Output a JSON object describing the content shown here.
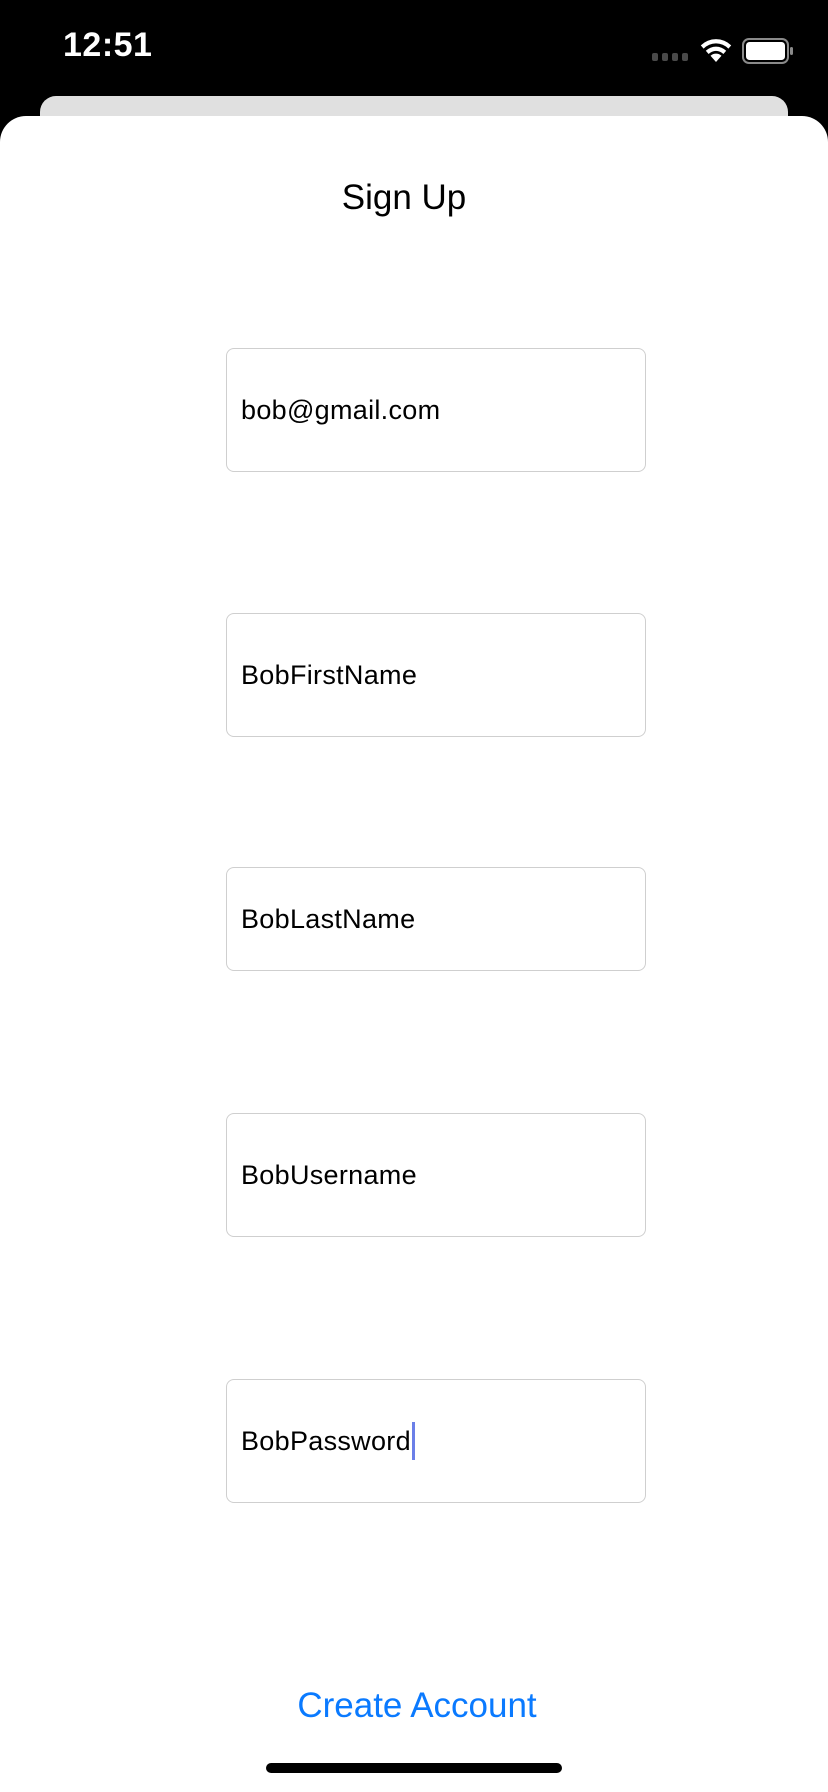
{
  "status_bar": {
    "time": "12:51"
  },
  "sheet": {
    "title": "Sign Up",
    "fields": {
      "email": "bob@gmail.com",
      "first_name": "BobFirstName",
      "last_name": "BobLastName",
      "username": "BobUsername",
      "password": "BobPassword"
    },
    "create_account_label": "Create Account"
  },
  "icons": {
    "signal": "cellular-signal-icon",
    "wifi": "wifi-icon",
    "battery": "battery-icon"
  },
  "colors": {
    "accent": "#0a7aff",
    "caret": "#6b7fe8",
    "field_border": "#cfcfcf",
    "back_sheet": "#e0e0e0"
  }
}
